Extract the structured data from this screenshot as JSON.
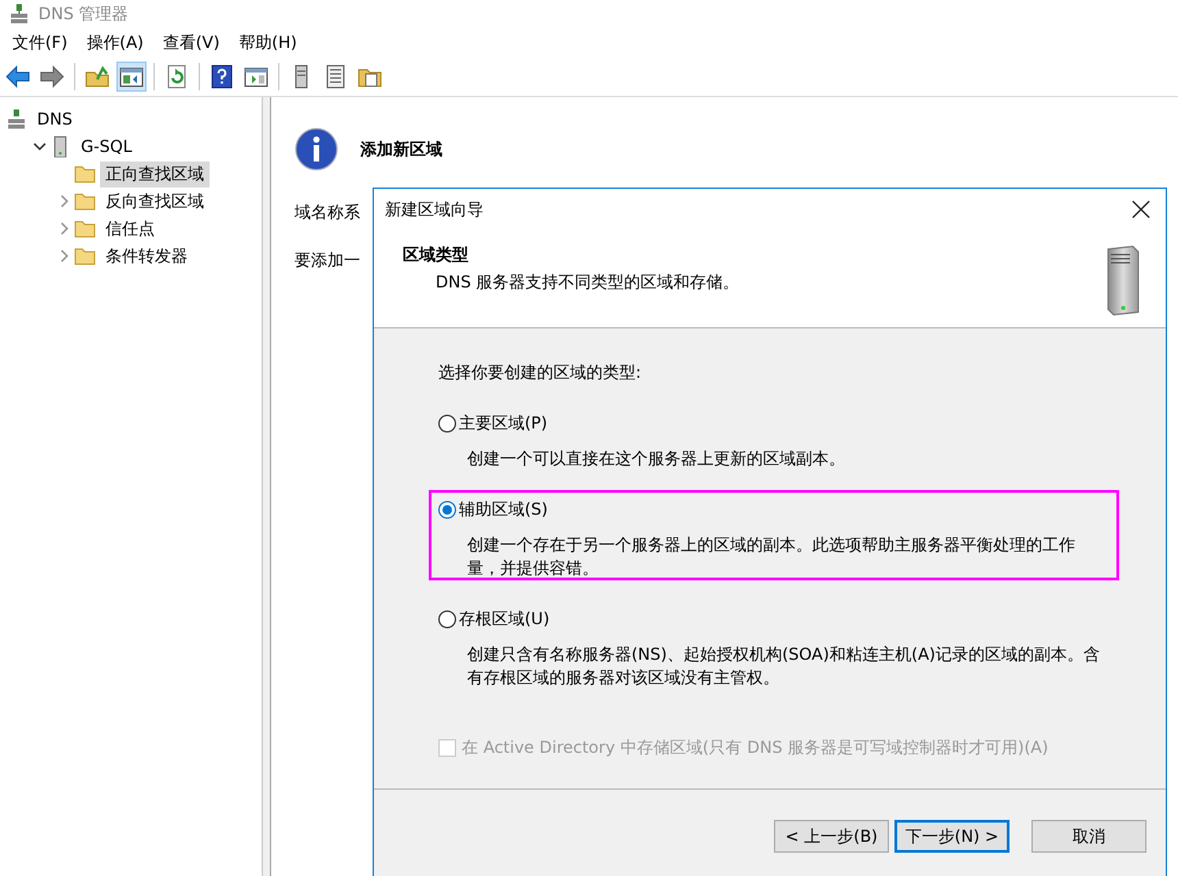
{
  "window": {
    "title": "DNS 管理器"
  },
  "menu": [
    "文件(F)",
    "操作(A)",
    "查看(V)",
    "帮助(H)"
  ],
  "toolbar": [
    [
      {
        "kind": "back",
        "pressed": false
      },
      {
        "kind": "forward",
        "pressed": false
      }
    ],
    [
      {
        "kind": "up",
        "pressed": false
      },
      {
        "kind": "tree",
        "pressed": true
      }
    ],
    [
      {
        "kind": "refresh",
        "pressed": false
      }
    ],
    [
      {
        "kind": "help",
        "pressed": false
      },
      {
        "kind": "pane",
        "pressed": false
      }
    ],
    [
      {
        "kind": "server",
        "pressed": false
      },
      {
        "kind": "list",
        "pressed": false
      },
      {
        "kind": "folder",
        "pressed": false
      }
    ]
  ],
  "tree": [
    {
      "label": "DNS",
      "kind": "root",
      "selected": false,
      "children": [
        {
          "label": "G-SQL",
          "kind": "server",
          "selected": false,
          "expanded": true,
          "children": [
            {
              "label": "正向查找区域",
              "kind": "folder",
              "selected": true,
              "expandable": false
            },
            {
              "label": "反向查找区域",
              "kind": "folder",
              "selected": false,
              "expandable": true
            },
            {
              "label": "信任点",
              "kind": "folder",
              "selected": false,
              "expandable": true
            },
            {
              "label": "条件转发器",
              "kind": "folder",
              "selected": false,
              "expandable": true
            }
          ]
        }
      ]
    }
  ],
  "content": {
    "heading": "添加新区域",
    "lines": [
      "域名称系",
      "要添加一"
    ]
  },
  "wizard": {
    "title": "新建区域向导",
    "header": {
      "title": "区域类型",
      "subtitle": "DNS 服务器支持不同类型的区域和存储。"
    },
    "prompt": "选择你要创建的区域的类型:",
    "options": [
      {
        "label": "主要区域(P)",
        "description": "创建一个可以直接在这个服务器上更新的区域副本。",
        "selected": false,
        "highlighted": false
      },
      {
        "label": "辅助区域(S)",
        "description": "创建一个存在于另一个服务器上的区域的副本。此选项帮助主服务器平衡处理的工作量，并提供容错。",
        "selected": true,
        "highlighted": true
      },
      {
        "label": "存根区域(U)",
        "description": "创建只含有名称服务器(NS)、起始授权机构(SOA)和粘连主机(A)记录的区域的副本。含有存根区域的服务器对该区域没有主管权。",
        "selected": false,
        "highlighted": false
      }
    ],
    "store_in_ad": {
      "label": "在 Active Directory 中存储区域(只有 DNS 服务器是可写域控制器时才可用)(A)",
      "checked": false,
      "disabled": true
    },
    "buttons": [
      {
        "label": "< 上一步(B)",
        "default": false
      },
      {
        "label": "下一步(N) >",
        "default": true
      },
      {
        "label": "取消",
        "default": false
      }
    ]
  }
}
